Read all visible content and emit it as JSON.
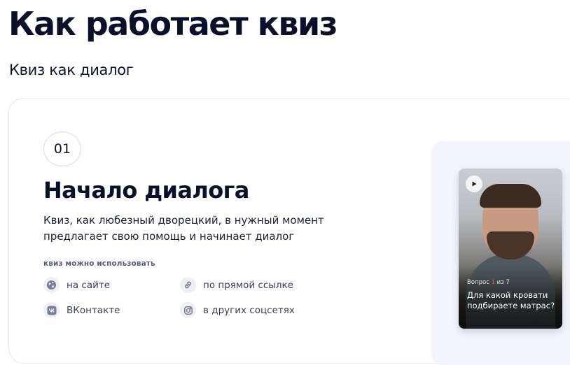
{
  "page": {
    "title": "Как работает квиз",
    "subtitle": "Квиз как диалог"
  },
  "step": {
    "number": "01",
    "title": "Начало диалога",
    "description": "Квиз, как любезный дворецкий, в нужный момент предлагает свою помощь и начинает диалог",
    "use_label": "квиз можно использовать",
    "channels": [
      {
        "label": "на сайте",
        "icon": "globe-icon"
      },
      {
        "label": "по прямой ссылке",
        "icon": "link-icon"
      },
      {
        "label": "ВКонтакте",
        "icon": "vk-icon"
      },
      {
        "label": "в других соцсетях",
        "icon": "instagram-icon"
      }
    ]
  },
  "preview": {
    "counter_prefix": "Вопрос ",
    "counter_current": "1",
    "counter_suffix": " из 7",
    "question": "Для какой кровати подбираете матрас?",
    "play_icon": "play-icon"
  },
  "colors": {
    "accent_red": "#ff4b4b",
    "text_dark": "#0b1029",
    "icon_bg": "#eef0f5"
  }
}
